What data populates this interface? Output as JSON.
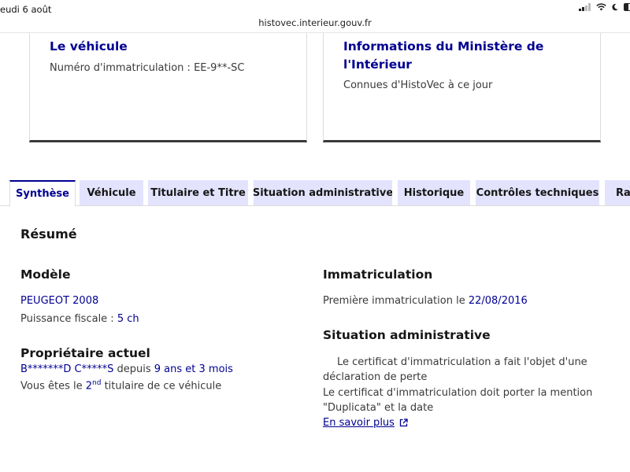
{
  "status_bar": {
    "date": "eudi 6 août"
  },
  "browser": {
    "url": "histovec.interieur.gouv.fr"
  },
  "cards": {
    "vehicule": {
      "title": "Le véhicule",
      "text": "Numéro d'immatriculation : EE-9**-SC"
    },
    "ministere": {
      "title": "Informations du Ministère de l'Intérieur",
      "text": "Connues d'HistoVec à ce jour"
    }
  },
  "tabs": [
    {
      "label": "Synthèse",
      "active": true
    },
    {
      "label": "Véhicule",
      "active": false
    },
    {
      "label": "Titulaire et Titre",
      "active": false
    },
    {
      "label": "Situation administrative",
      "active": false
    },
    {
      "label": "Historique",
      "active": false
    },
    {
      "label": "Contrôles techniques",
      "active": false
    },
    {
      "label": "Rap",
      "active": false
    }
  ],
  "summary": {
    "title": "Résumé",
    "modele": {
      "heading": "Modèle",
      "model_name": "PEUGEOT 2008",
      "puissance_label": "Puissance fiscale : ",
      "puissance_value": "5 ch"
    },
    "proprietaire": {
      "heading": "Propriétaire actuel",
      "owner_name": "B*******D C*****S",
      "depuis_label": " depuis ",
      "duration": "9 ans et 3 mois",
      "rank_prefix": "Vous êtes le ",
      "rank_number": "2",
      "rank_suffix": "nd",
      "rank_tail": " titulaire de ce véhicule"
    },
    "immatriculation": {
      "heading": "Immatriculation",
      "label": "Première immatriculation le ",
      "date": "22/08/2016"
    },
    "situation": {
      "heading": "Situation administrative",
      "line1": "Le certificat d'immatriculation a fait l'objet d'une",
      "line2": "déclaration de perte",
      "line3": "Le certificat d'immatriculation doit porter la mention",
      "line4": "\"Duplicata\" et la date",
      "link": "En savoir plus"
    }
  },
  "colors": {
    "accent": "#000091",
    "tab_bg": "#e3e3fd",
    "text": "#3a3a3a"
  }
}
